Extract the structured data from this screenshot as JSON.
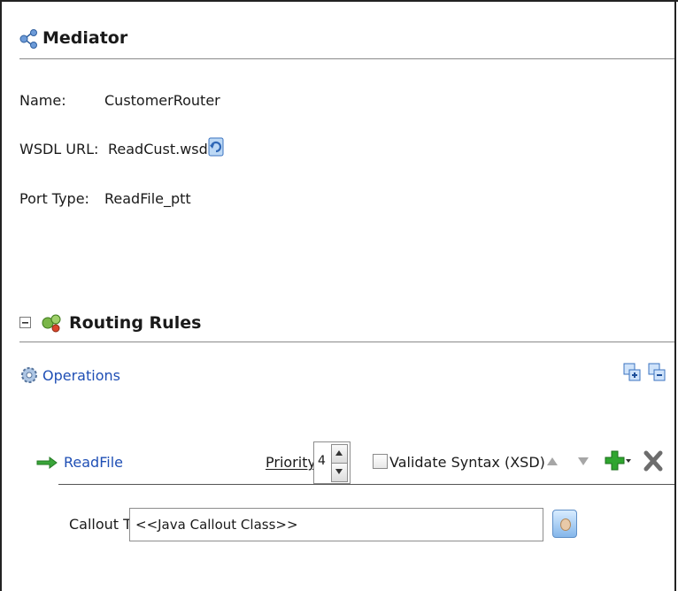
{
  "mediator": {
    "title": "Mediator",
    "name_label": "Name:",
    "name_value": "CustomerRouter",
    "wsdl_label": "WSDL URL:",
    "wsdl_value": "ReadCust.wsdl",
    "port_label": "Port Type:",
    "port_value": "ReadFile_ptt"
  },
  "routing": {
    "title": "Routing Rules",
    "operations_label": "Operations",
    "rule": {
      "operation": "ReadFile",
      "priority_label": "Priority",
      "priority_value": "4",
      "validate_label": "Validate Syntax (XSD)",
      "callout_label": "Callout To",
      "callout_value": "<<Java Callout Class>>"
    }
  },
  "colors": {
    "link": "#1f4fb5",
    "add": "#2fa52f",
    "remove": "#6d6d6d"
  },
  "icons": [
    "mediator-icon",
    "refresh-wsdl-icon",
    "collapse-icon",
    "routing-rules-icon",
    "operations-gear-icon",
    "expand-all-icon",
    "collapse-all-icon",
    "arrow-right-icon",
    "move-up-icon",
    "move-down-icon",
    "add-icon",
    "delete-icon",
    "browse-icon"
  ]
}
